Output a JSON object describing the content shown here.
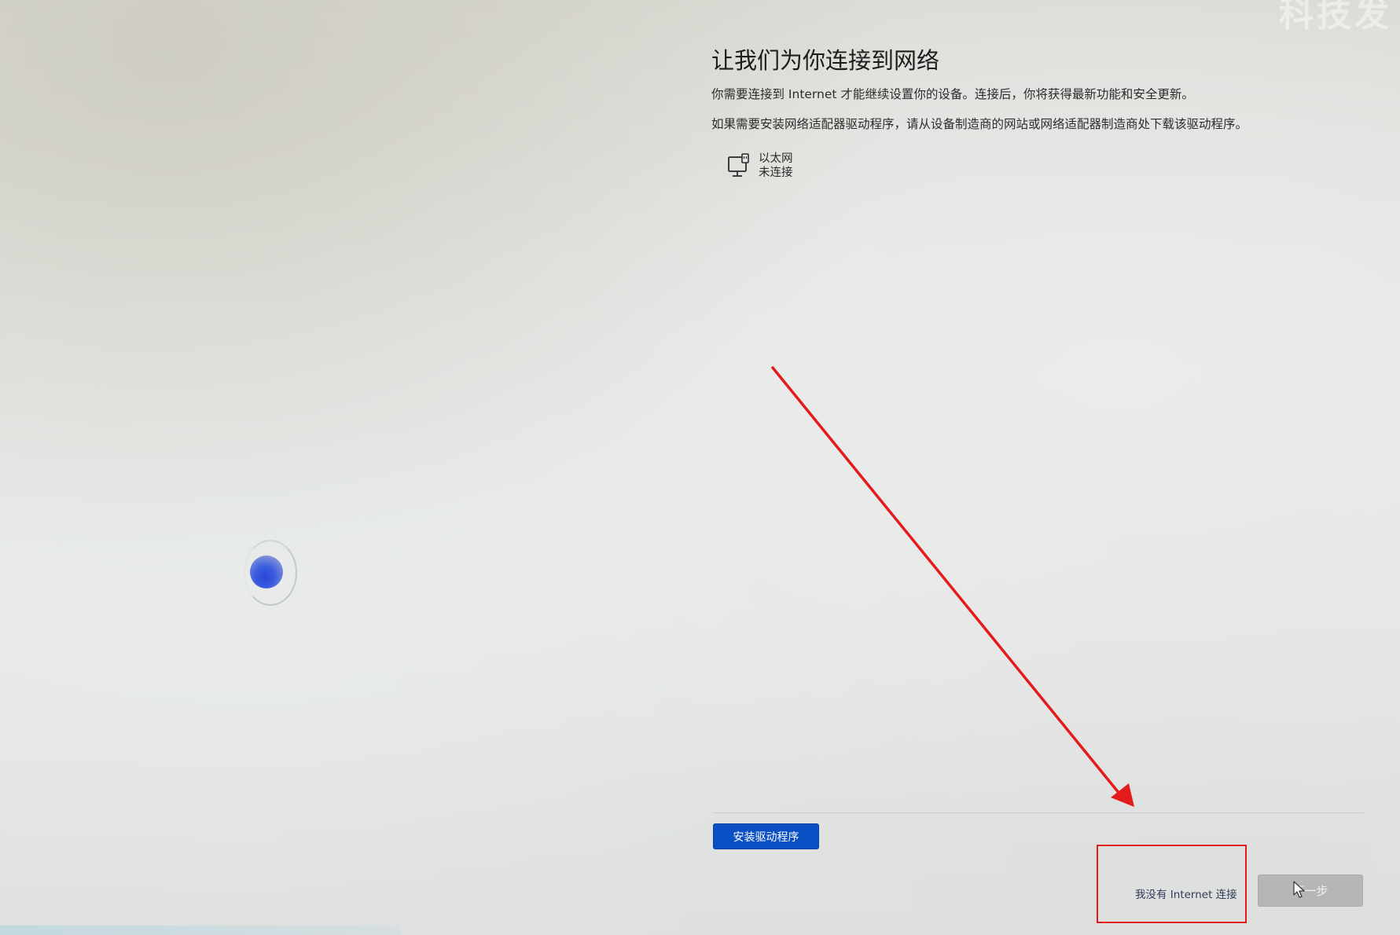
{
  "watermark": "科技发",
  "header": {
    "title": "让我们为你连接到网络",
    "paragraph_1": "你需要连接到 Internet 才能继续设置你的设备。连接后，你将获得最新功能和安全更新。",
    "paragraph_2": "如果需要安装网络适配器驱动程序，请从设备制造商的网站或网络适配器制造商处下载该驱动程序。"
  },
  "network": {
    "icon": "ethernet-monitor-icon",
    "name": "以太网",
    "status": "未连接"
  },
  "actions": {
    "install_driver_label": "安装驱动程序",
    "no_internet_label": "我没有 Internet 连接",
    "next_label": "下一步"
  },
  "colors": {
    "primary_button": "#0a4fc4",
    "disabled_button": "#b4b6b8",
    "annotation_red": "#e31b1b",
    "spinner_blue": "#2846d6"
  }
}
